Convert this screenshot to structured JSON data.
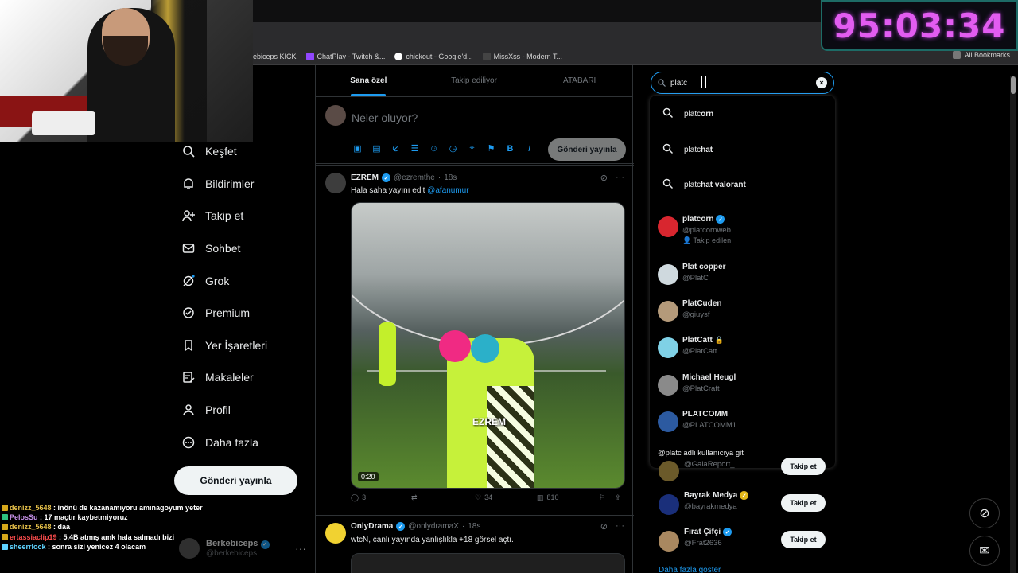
{
  "timer": "95:03:34",
  "bookmarks": [
    {
      "label": "ebiceps KICK"
    },
    {
      "label": "ChatPlay - Twitch &..."
    },
    {
      "label": "chickout - Google'd..."
    },
    {
      "label": "MissXss - Modern T..."
    }
  ],
  "bookmarks_all": "All Bookmarks",
  "nav": {
    "items": [
      {
        "label": "Keşfet"
      },
      {
        "label": "Bildirimler"
      },
      {
        "label": "Takip et"
      },
      {
        "label": "Sohbet"
      },
      {
        "label": "Grok"
      },
      {
        "label": "Premium"
      },
      {
        "label": "Yer İşaretleri"
      },
      {
        "label": "Makaleler"
      },
      {
        "label": "Profil"
      },
      {
        "label": "Daha fazla"
      }
    ],
    "post_button": "Gönderi yayınla",
    "profile": {
      "name": "Berkebiceps",
      "handle": "@berkebiceps"
    }
  },
  "chat": [
    {
      "user": "denizz_5648",
      "user_color": "#e6c04a",
      "text": " : inönü de kazanamıyoru amınagoyum yeter"
    },
    {
      "user": "PelosSu",
      "user_color": "#c792ea",
      "text": " : 17 maçtır kaybetmiyoruz"
    },
    {
      "user": "denizz_5648",
      "user_color": "#e6c04a",
      "text": " : daa"
    },
    {
      "user": "ertassiaclip19",
      "user_color": "#ff4d4d",
      "text": " : 5,4B atmış amk hala salmadı bizi"
    },
    {
      "user": "sheerrlock",
      "user_color": "#5fd3ff",
      "text": " : sonra sizi yenicez 4 olacam"
    }
  ],
  "feed": {
    "tabs": [
      {
        "label": "Sana özel"
      },
      {
        "label": "Takip ediliyor"
      },
      {
        "label": "ATABARI"
      }
    ],
    "composer_placeholder": "Neler oluyor?",
    "composer_send": "Gönderi yayınla",
    "tweet1": {
      "name": "EZREM",
      "handle": "@ezremthe",
      "time": "18s",
      "text": "Hala saha yayını edit ",
      "mention": "@afanumur",
      "media_watermark": "EZREM",
      "duration": "0:20",
      "replies": "3",
      "likes": "34",
      "views": "810"
    },
    "tweet2": {
      "name": "OnlyDrama",
      "handle": "@onlydramaX",
      "time": "18s",
      "text": "wtcN, canlı yayında yanlışlıkla +18 görsel açtı."
    }
  },
  "search": {
    "value": "platc",
    "suggestions": [
      {
        "prefix": "platc",
        "rest": "orn"
      },
      {
        "prefix": "platc",
        "rest": "hat"
      },
      {
        "prefix": "platc",
        "rest": "hat valorant"
      }
    ],
    "users": [
      {
        "name": "platcorn",
        "handle": "@platcornweb",
        "verified": true,
        "follow_note": "Takip edilen",
        "avatar_color": "#d8262f"
      },
      {
        "name": "Plat copper",
        "handle": "@PlatC",
        "verified": false,
        "avatar_color": "#cfd9de"
      },
      {
        "name": "PlatCuden",
        "handle": "@giuysf",
        "verified": false,
        "avatar_color": "#b49a7a"
      },
      {
        "name": "PlatCatt",
        "handle": "@PlatCatt",
        "verified": false,
        "locked": true,
        "avatar_color": "#7fd1e6"
      },
      {
        "name": "Michael Heugl",
        "handle": "@PlatCraft",
        "verified": false,
        "avatar_color": "#8a8a8a"
      },
      {
        "name": "PLATCOMM",
        "handle": "@PLATCOMM1",
        "verified": false,
        "avatar_color": "#2c5aa0"
      }
    ],
    "goto": "@platc adlı kullanıcıya git"
  },
  "who_to_follow": {
    "rows": [
      {
        "name": "",
        "handle": "@GalaReport_",
        "button": "Takip et",
        "avatar_color": "#6b5a2a"
      },
      {
        "name": "Bayrak Medya",
        "handle": "@bayrakmedya",
        "verified_gold": true,
        "button": "Takip et",
        "avatar_color": "#1a2f7a"
      },
      {
        "name": "Fırat Çifçi",
        "handle": "@Frat2636",
        "verified": true,
        "button": "Takip et",
        "avatar_color": "#a98860"
      }
    ],
    "more": "Daha fazla göster"
  }
}
